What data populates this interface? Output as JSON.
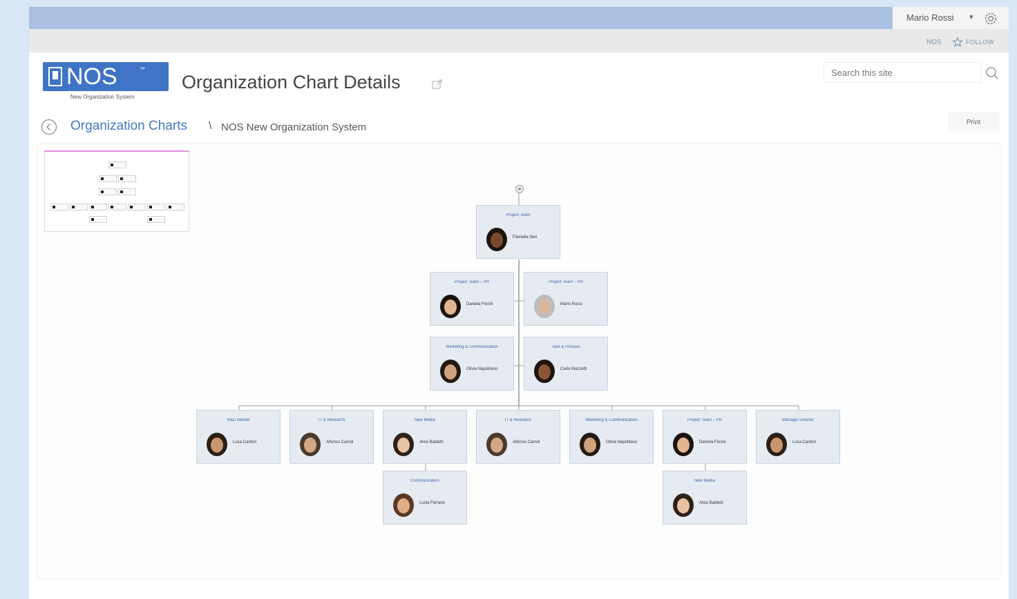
{
  "header": {
    "user_name": "Mario Rossi",
    "nos_link": "NOS",
    "follow_label": "FOLLOW"
  },
  "logo": {
    "text": "NOS",
    "tm": "™",
    "subtitle": "New Organization System"
  },
  "page": {
    "title": "Organization Chart Details"
  },
  "search": {
    "placeholder": "Search this site"
  },
  "breadcrumb": {
    "link": "Organization Charts",
    "separator": "\\",
    "current": "NOS New Organization System"
  },
  "toolbar": {
    "print_label": "Print"
  },
  "org_chart": {
    "nodes": [
      {
        "id": "root",
        "title": "Project Team",
        "name": "Fiamella Neri",
        "skin": "#7a4a30",
        "hair": "#1d1410"
      },
      {
        "id": "l1a",
        "title": "Project Team – PR",
        "name": "Daniela Fiorini",
        "skin": "#e2b48f",
        "hair": "#1a1410"
      },
      {
        "id": "l1b",
        "title": "Project Team – PR",
        "name": "Mario Rossi",
        "skin": "#d9b79a",
        "hair": "#bdbdbd"
      },
      {
        "id": "l2a",
        "title": "Marketing & Communication",
        "name": "Olivia Napolitano",
        "skin": "#d2a27c",
        "hair": "#221a14"
      },
      {
        "id": "l2b",
        "title": "Task & Process",
        "name": "Carlo Mazzetti",
        "skin": "#8a5634",
        "hair": "#1e1510"
      },
      {
        "id": "b1",
        "title": "R&D Market",
        "name": "Luca Cantori",
        "skin": "#c99670",
        "hair": "#2b1f16"
      },
      {
        "id": "b2",
        "title": "IT & Research",
        "name": "Alfonso Carroli",
        "skin": "#d2a886",
        "hair": "#4a3a2c"
      },
      {
        "id": "b3",
        "title": "New Media",
        "name": "Alice Baldetti",
        "skin": "#e7c3a4",
        "hair": "#2e2119"
      },
      {
        "id": "b4",
        "title": "IT & Research",
        "name": "Alfonso Carroli",
        "skin": "#d2a886",
        "hair": "#4a3a2c"
      },
      {
        "id": "b5",
        "title": "Marketing & Communication",
        "name": "Olivia Napolitano",
        "skin": "#d2a27c",
        "hair": "#221a14"
      },
      {
        "id": "b6",
        "title": "Project Team – PR",
        "name": "Daniela Fiorini",
        "skin": "#e2b48f",
        "hair": "#1a1410"
      },
      {
        "id": "b7",
        "title": "Manager Director",
        "name": "Luca Cantori",
        "skin": "#c99670",
        "hair": "#2b1f16"
      },
      {
        "id": "c1",
        "title": "Communication",
        "name": "Lucia Ferrario",
        "skin": "#e0ad86",
        "hair": "#5a3a24"
      },
      {
        "id": "c2",
        "title": "New Media",
        "name": "Alice Baldetti",
        "skin": "#e7c3a4",
        "hair": "#2e2119"
      }
    ]
  },
  "colors": {
    "accent": "#4178c0",
    "topbar": "#a9c0e3",
    "node_bg": "#e6ebf2",
    "connector": "#8a8a8a"
  }
}
